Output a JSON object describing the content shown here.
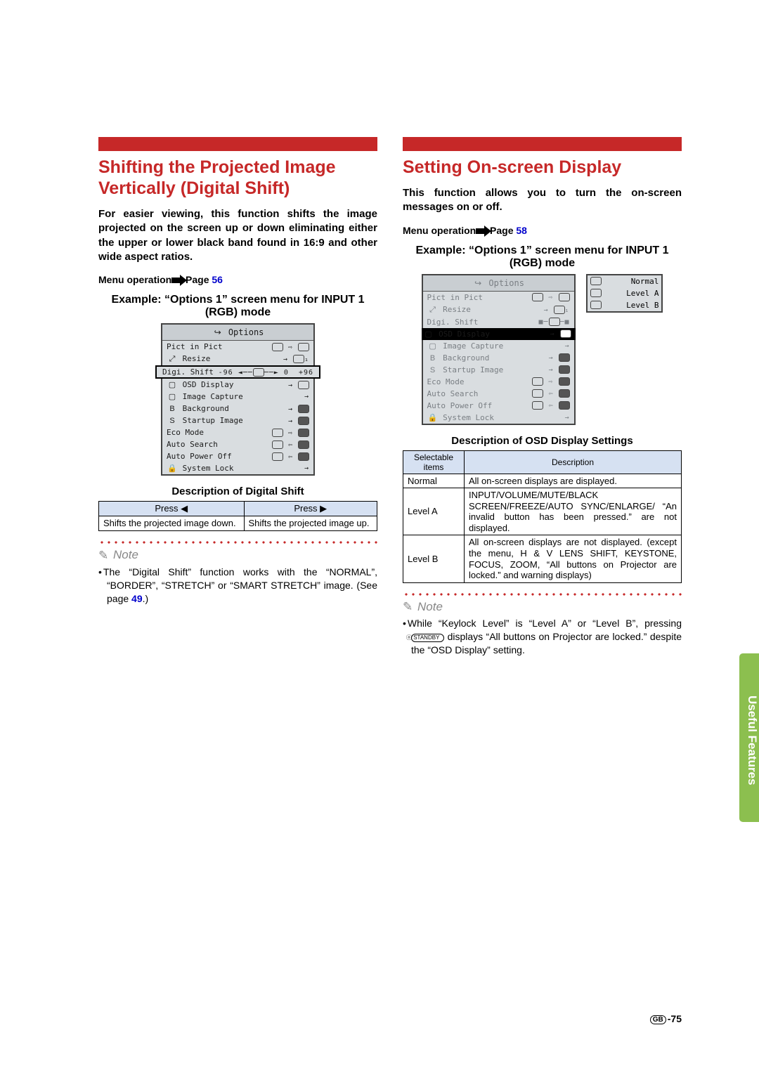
{
  "left": {
    "title": "Shifting the Projected Image Vertically (Digital Shift)",
    "intro": "For easier viewing, this function shifts the image projected on the screen up or down eliminating either the upper or lower black band found in 16:9 and other wide aspect ratios.",
    "menu_op_label": "Menu operation",
    "menu_op_page_label": "Page",
    "menu_op_page": "56",
    "example_heading": "Example: “Options 1” screen menu for INPUT 1 (RGB) mode",
    "menu": {
      "header": "Options",
      "items": [
        "Pict in Pict",
        "Resize",
        "Digi. Shift",
        "OSD Display",
        "Image Capture",
        "Background",
        "Startup Image",
        "Eco Mode",
        "Auto Search",
        "Auto Power Off",
        "System Lock"
      ],
      "shift_min": "-96",
      "shift_val": "0",
      "shift_max": "+96"
    },
    "shift_desc_heading": "Description of Digital Shift",
    "shift_table": {
      "head_left": "Press ◀",
      "head_right": "Press ▶",
      "cell_left": "Shifts the projected image down.",
      "cell_right": "Shifts the projected image up."
    },
    "note_label": "Note",
    "note_body_pre": "The “Digital Shift” function works with the “NORMAL”, “BORDER”, “STRETCH” or “SMART STRETCH” image. (See page ",
    "note_page": "49",
    "note_body_post": ".)"
  },
  "right": {
    "title": "Setting On-screen Display",
    "intro": "This function allows you to turn the on-screen messages on or off.",
    "menu_op_label": "Menu operation",
    "menu_op_page_label": "Page",
    "menu_op_page": "58",
    "example_heading": "Example: “Options 1” screen menu for INPUT 1 (RGB) mode",
    "menu": {
      "header": "Options",
      "items": [
        "Pict in Pict",
        "Resize",
        "Digi. Shift",
        "OSD Display",
        "Image Capture",
        "Background",
        "Startup Image",
        "Eco Mode",
        "Auto Search",
        "Auto Power Off",
        "System Lock"
      ]
    },
    "callout": [
      "Normal",
      "Level A",
      "Level B"
    ],
    "osd_desc_heading": "Description of OSD Display Settings",
    "osd_table": {
      "head_sel": "Selectable items",
      "head_desc": "Description",
      "rows": [
        {
          "sel": "Normal",
          "desc": "All on-screen displays are displayed."
        },
        {
          "sel": "Level A",
          "desc": "INPUT/VOLUME/MUTE/BLACK SCREEN/FREEZE/AUTO SYNC/ENLARGE/ “An invalid button has been pressed.” are not displayed."
        },
        {
          "sel": "Level B",
          "desc": "All on-screen displays are not displayed. (except the menu, H & V LENS SHIFT, KEYSTONE, FOCUS, ZOOM, “All buttons on Projector are locked.” and warning displays)"
        }
      ]
    },
    "note_label": "Note",
    "note_body_pre": "While “Keylock Level” is “Level A” or “Level B”, pressing ",
    "note_button": "ⓞ STANDBY",
    "note_body_post": " displays “All buttons on Projector are locked.” despite the “OSD Display” setting."
  },
  "side_tab": "Useful Features",
  "page_num_prefix": "GB",
  "page_num": "-75"
}
